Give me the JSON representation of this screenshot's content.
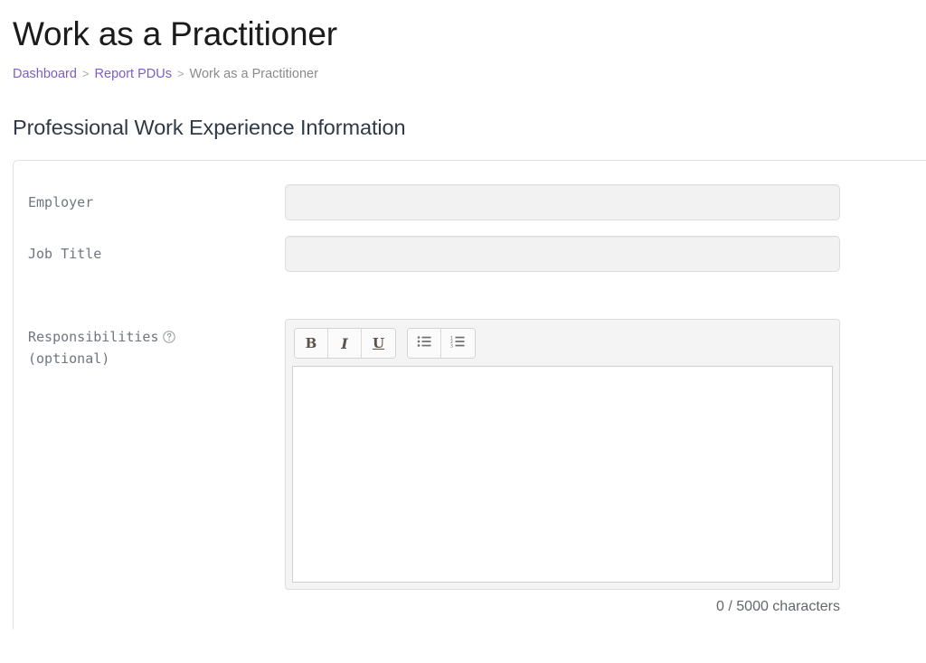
{
  "page": {
    "title": "Work as a Practitioner"
  },
  "breadcrumb": {
    "separator": ">",
    "items": [
      {
        "label": "Dashboard",
        "link": true
      },
      {
        "label": "Report PDUs",
        "link": true
      },
      {
        "label": "Work as a Practitioner",
        "link": false
      }
    ]
  },
  "section": {
    "heading": "Professional Work Experience Information"
  },
  "form": {
    "employer": {
      "label": "Employer",
      "value": "",
      "placeholder": ""
    },
    "job_title": {
      "label": "Job Title",
      "value": "",
      "placeholder": ""
    },
    "responsibilities": {
      "label": "Responsibilities",
      "optional_label": "(optional)",
      "help_icon": "question-circle-icon",
      "value": "",
      "placeholder": "",
      "char_count": "0 / 5000 characters",
      "toolbar": [
        {
          "name": "bold-button",
          "label": "B"
        },
        {
          "name": "italic-button",
          "label": "I"
        },
        {
          "name": "underline-button",
          "label": "U"
        },
        {
          "name": "bullet-list-button",
          "label": ""
        },
        {
          "name": "numbered-list-button",
          "label": ""
        }
      ]
    }
  },
  "colors": {
    "link": "#7b5ec7",
    "muted_text": "#8a8a8a",
    "heading": "#2f3a46",
    "label": "#6f7680",
    "input_bg": "#f2f2f2",
    "border": "#dcdcdc"
  }
}
